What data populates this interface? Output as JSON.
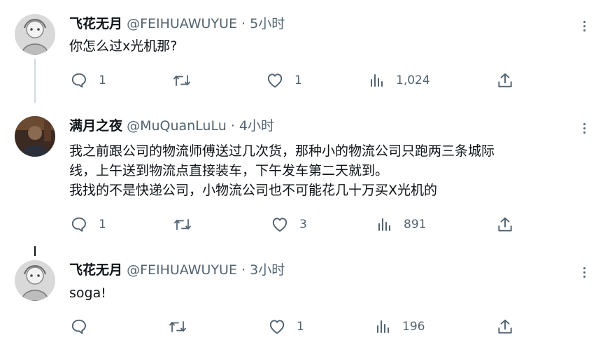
{
  "tweets": [
    {
      "name": "飞花无月",
      "handle": "@FEIHUAWUYUE",
      "separator": "·",
      "time": "5小时",
      "lines": [
        "你怎么过x光机那?"
      ],
      "replies": "1",
      "retweets": "",
      "likes": "1",
      "views": "1,024"
    },
    {
      "name": "满月之夜",
      "handle": "@MuQuanLuLu",
      "separator": "·",
      "time": "4小时",
      "lines": [
        "我之前跟公司的物流师傅送过几次货，那种小的物流公司只跑两三条城际",
        "线，上午送到物流点直接装车，下午发车第二天就到。",
        "我找的不是快递公司，小物流公司也不可能花几十万买X光机的"
      ],
      "replies": "1",
      "retweets": "",
      "likes": "3",
      "views": "891"
    },
    {
      "name": "飞花无月",
      "handle": "@FEIHUAWUYUE",
      "separator": "·",
      "time": "3小时",
      "lines": [
        "soga!"
      ],
      "replies": "",
      "retweets": "",
      "likes": "1",
      "views": "196"
    }
  ],
  "icons": {
    "reply": "reply-icon",
    "retweet": "retweet-icon",
    "like": "like-icon",
    "views": "views-icon",
    "share": "share-icon",
    "more": "more-icon"
  },
  "colors": {
    "text": "#0f1419",
    "secondary": "#536471",
    "thread_line": "#cfd9de"
  }
}
